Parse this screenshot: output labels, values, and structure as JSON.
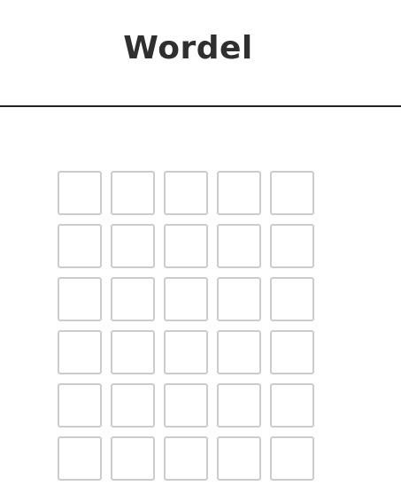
{
  "header": {
    "title": "Wordel"
  },
  "board": {
    "rows": [
      [
        "",
        "",
        "",
        "",
        ""
      ],
      [
        "",
        "",
        "",
        "",
        ""
      ],
      [
        "",
        "",
        "",
        "",
        ""
      ],
      [
        "",
        "",
        "",
        "",
        ""
      ],
      [
        "",
        "",
        "",
        "",
        ""
      ],
      [
        "",
        "",
        "",
        "",
        ""
      ]
    ]
  },
  "colors": {
    "title": "#2f2f2f",
    "divider": "#222222",
    "tile_border": "#cccccc",
    "background": "#ffffff"
  }
}
